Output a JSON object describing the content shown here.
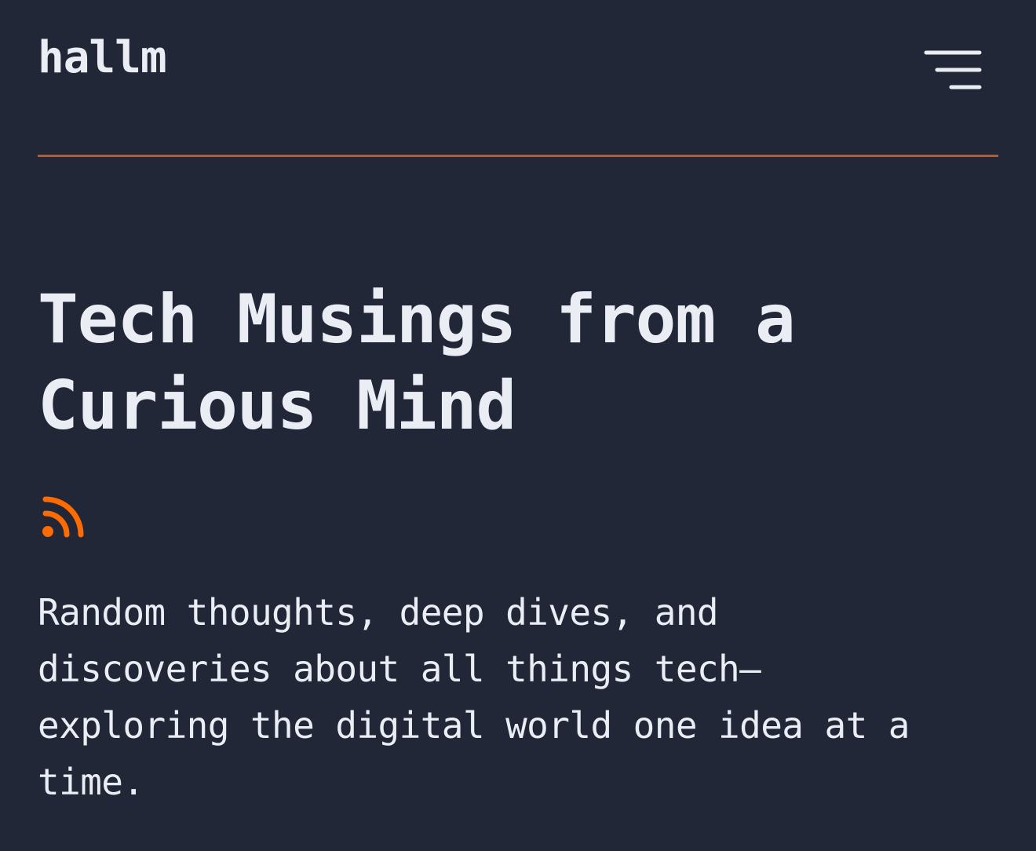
{
  "header": {
    "site_title": "hallm",
    "menu_icon": "hamburger-menu-icon"
  },
  "hero": {
    "title": "Tech Musings from a\nCurious Mind",
    "rss_icon": "rss-icon",
    "tagline": "Random thoughts, deep dives, and\ndiscoveries about all things tech—\nexploring the digital world one idea at a\ntime."
  },
  "colors": {
    "background": "#212737",
    "text": "#eaedf3",
    "accent": "#ff6b01",
    "divider": "#c5561b"
  }
}
